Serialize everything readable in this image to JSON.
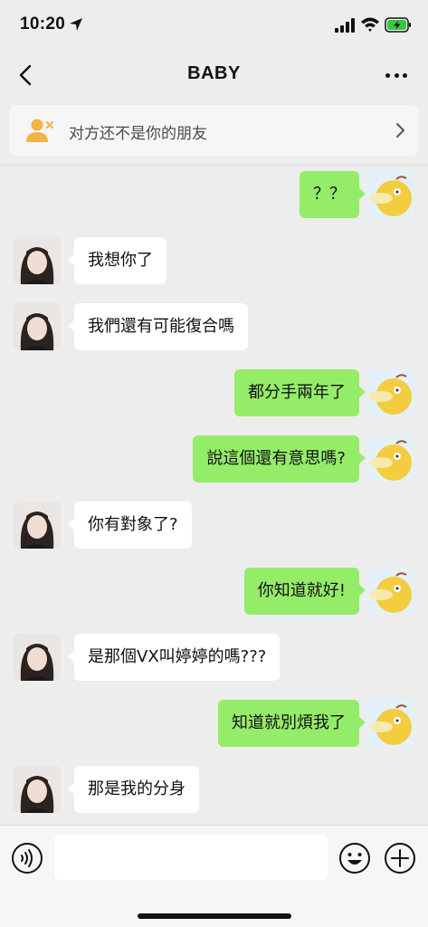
{
  "status_bar": {
    "time": "10:20"
  },
  "nav": {
    "title": "BABY"
  },
  "banner": {
    "text": "对方还不是你的朋友"
  },
  "messages": [
    {
      "side": "me",
      "text": "？？"
    },
    {
      "side": "her",
      "text": "我想你了"
    },
    {
      "side": "her",
      "text": "我們還有可能復合嗎"
    },
    {
      "side": "me",
      "text": "都分手兩年了"
    },
    {
      "side": "me",
      "text": "說這個還有意思嗎?"
    },
    {
      "side": "her",
      "text": "你有對象了?"
    },
    {
      "side": "me",
      "text": "你知道就好!"
    },
    {
      "side": "her",
      "text": "是那個VX叫婷婷的嗎???"
    },
    {
      "side": "me",
      "text": "知道就別煩我了"
    },
    {
      "side": "her",
      "text": "那是我的分身"
    }
  ],
  "input": {
    "value": ""
  },
  "colors": {
    "my_bubble": "#95ec69",
    "her_bubble": "#ffffff",
    "background": "#ededed"
  }
}
